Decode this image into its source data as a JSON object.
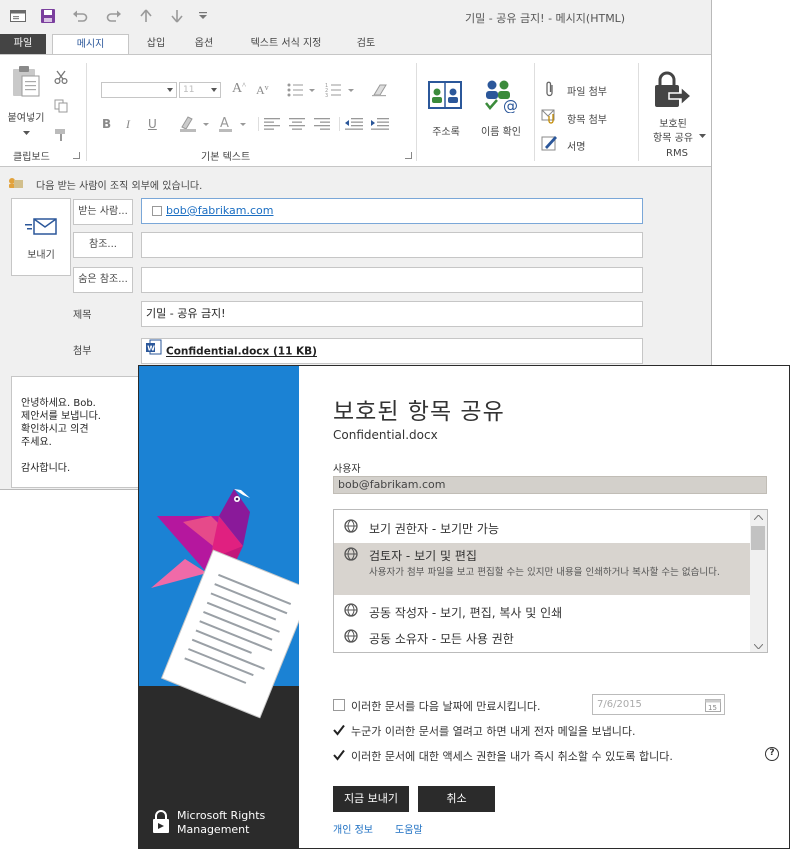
{
  "outlook": {
    "window_title": "기밀 - 공유 금지! - 메시지(HTML)",
    "tabs": [
      "파일",
      "메시지",
      "삽입",
      "옵션",
      "텍스트 서식 지정",
      "검토"
    ],
    "ribbon": {
      "paste": "붙여넣기",
      "clipboard_group": "클립보드",
      "font_size": "11",
      "basic_text_group": "기본 텍스트",
      "address_book": "주소록",
      "check_names": "이름 확인",
      "attach_file": "파일 첨부",
      "attach_item": "항목 첨부",
      "signature": "서명",
      "protected_share_1": "보호된",
      "protected_share_2": "항목 공유",
      "rms_group": "RMS"
    },
    "info_bar": "다음 받는 사람이 조직 외부에 있습니다.",
    "send": "보내기",
    "to_label": "받는 사람...",
    "to_value": "bob@fabrikam.com",
    "cc_label": "참조...",
    "bcc_label": "숨은 참조...",
    "subject_label": "제목",
    "subject_value": "기밀 - 공유 금지!",
    "attach_label": "첨부",
    "attachment": "Confidential.docx (11 KB)",
    "body": "안녕하세요. Bob.\n제안서를 보냅니다.\n확인하시고 의견\n주세요.\n\n감사합니다."
  },
  "dialog": {
    "title": "보호된 항목 공유",
    "filename": "Confidential.docx",
    "users_label": "사용자",
    "users_value": "bob@fabrikam.com",
    "permissions": [
      {
        "name": "보기 권한자 - 보기만 가능",
        "selected": false
      },
      {
        "name": "검토자 - 보기 및 편집",
        "desc": "사용자가 첨부 파일을 보고 편집할 수는 있지만 내용을 인쇄하거나 복사할 수는 없습니다.",
        "selected": true
      },
      {
        "name": "공동 작성자 - 보기, 편집, 복사 및 인쇄",
        "selected": false
      },
      {
        "name": "공동 소유자 - 모든 사용 권한",
        "selected": false
      }
    ],
    "expire_label": "이러한 문서를 다음 날짜에 만료시킵니다.",
    "expire_checked": false,
    "expire_date": "7/6/2015",
    "calendar_day": "15",
    "notify_label": "누군가 이러한 문서를 열려고 하면 내게 전자 메일을 보냅니다.",
    "notify_checked": true,
    "revoke_label": "이러한 문서에 대한 액세스 권한을 내가 즉시 취소할 수 있도록 합니다.",
    "revoke_checked": true,
    "help": "?",
    "send_now": "지금 보내기",
    "cancel": "취소",
    "privacy": "개인 정보",
    "help_link": "도움말",
    "brand": "Microsoft Rights\nManagement"
  },
  "colors": {
    "accent": "#2b579a",
    "rms_blue": "#1b82d4",
    "dark": "#2b2b2b",
    "outlook_purple": "#7b3f9e"
  }
}
